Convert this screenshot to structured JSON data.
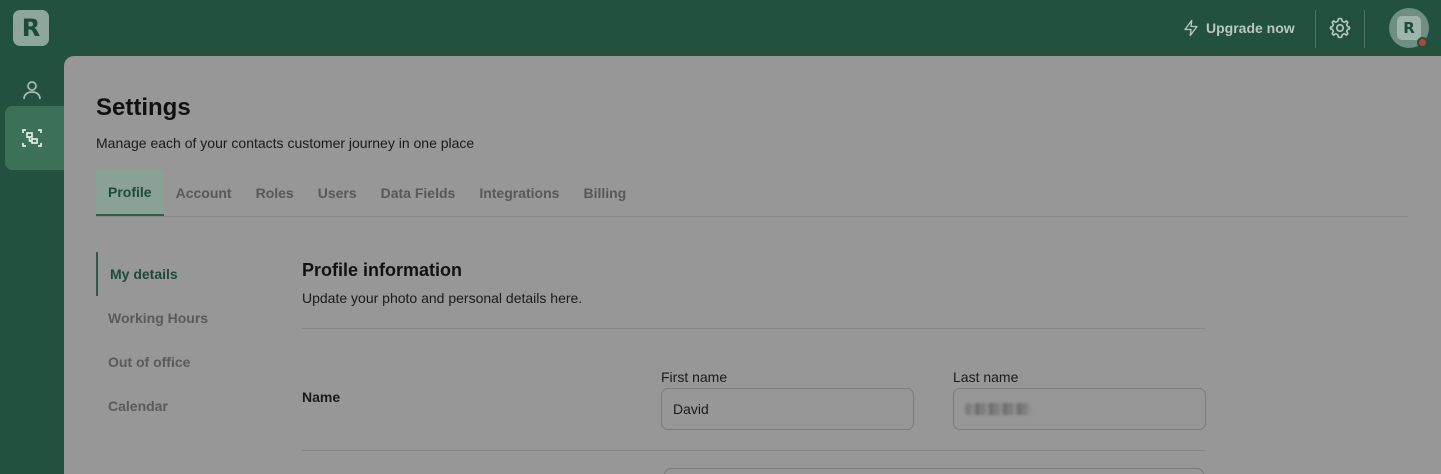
{
  "app": {
    "logo_letter": "R",
    "avatar_letter": "R"
  },
  "header": {
    "upgrade_label": "Upgrade now"
  },
  "page": {
    "title": "Settings",
    "subtitle": "Manage each of your contacts customer journey in one place"
  },
  "tabs": [
    {
      "label": "Profile",
      "active": true
    },
    {
      "label": "Account"
    },
    {
      "label": "Roles"
    },
    {
      "label": "Users"
    },
    {
      "label": "Data Fields"
    },
    {
      "label": "Integrations"
    },
    {
      "label": "Billing"
    }
  ],
  "subnav": [
    {
      "label": "My details",
      "active": true
    },
    {
      "label": "Working Hours"
    },
    {
      "label": "Out of office"
    },
    {
      "label": "Calendar"
    }
  ],
  "profile": {
    "title": "Profile information",
    "subtitle": "Update your photo and personal details here.",
    "name_row_label": "Name",
    "first_name_label": "First name",
    "first_name_value": "David",
    "last_name_label": "Last name"
  },
  "icons": {
    "rail": [
      "user-icon",
      "workflow-icon"
    ],
    "header": [
      "lightning-icon",
      "gear-icon"
    ]
  },
  "colors": {
    "sidebar": "#23513f",
    "accent": "#1f4a39",
    "status_dot": "#b5453c"
  }
}
